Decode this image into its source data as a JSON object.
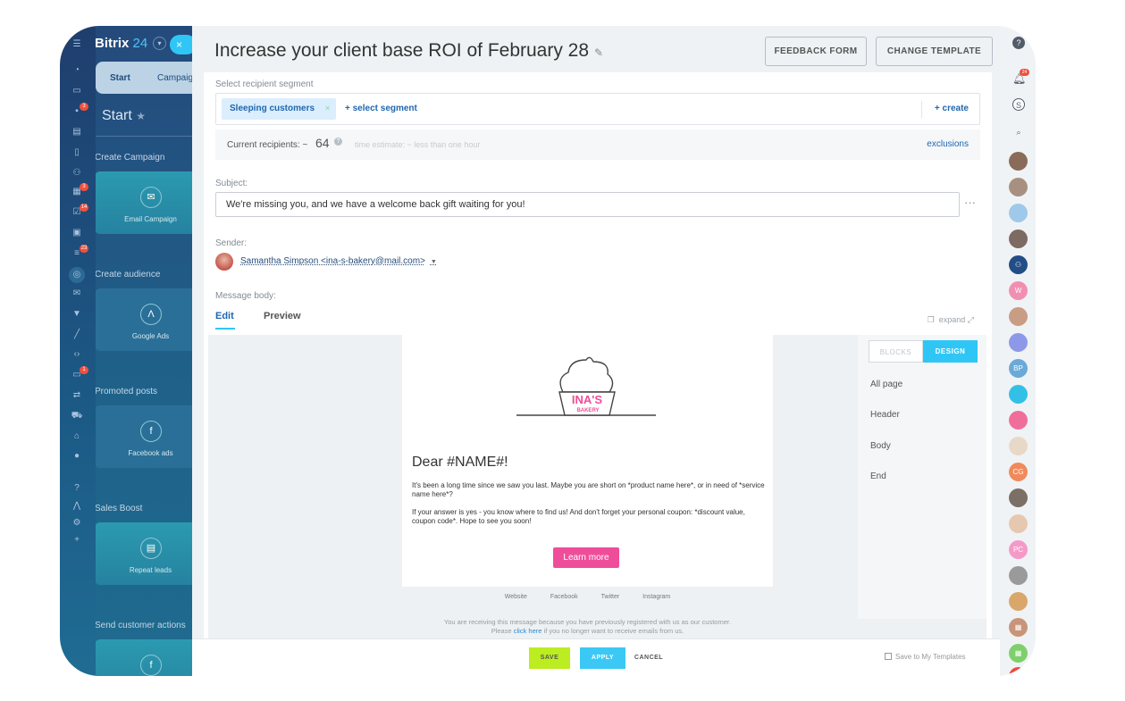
{
  "app": {
    "brand": "Bitrix",
    "brand_suffix": "24",
    "close_icon": "×"
  },
  "left_panel": {
    "tabs": [
      "Start",
      "Campaig"
    ],
    "start_title": "Start",
    "sections": [
      {
        "heading": "Create Campaign",
        "card": "Email Campaign",
        "icon": "envelope-icon"
      },
      {
        "heading": "Create audience",
        "card": "Google Ads",
        "icon": "google-ads-icon"
      },
      {
        "heading": "Promoted posts",
        "card": "Facebook ads",
        "icon": "facebook-icon"
      },
      {
        "heading": "Sales Boost",
        "card": "Repeat leads",
        "icon": "repeat-leads-icon"
      },
      {
        "heading": "Send customer actions",
        "card": "",
        "icon": "facebook-icon"
      }
    ]
  },
  "rail_badges": [
    "3",
    "3",
    "14",
    "23",
    "1"
  ],
  "header": {
    "title": "Increase your client base ROI of February 28",
    "feedback_button": "FEEDBACK FORM",
    "change_template_button": "CHANGE TEMPLATE"
  },
  "form": {
    "segment_label": "Select recipient segment",
    "segment_chip": "Sleeping customers",
    "select_segment": "+ select segment",
    "create": "+ create",
    "recipients_label": "Current recipients: ~",
    "recipients_count": "64",
    "time_estimate": "time estimate: ~ less than one hour",
    "exclusions": "exclusions",
    "subject_label": "Subject:",
    "subject_value": "We're missing you, and we have a welcome back gift waiting for you!",
    "sender_label": "Sender:",
    "sender_value": "Samantha Simpson <ina-s-bakery@mail.com>",
    "body_label": "Message body:",
    "tab_edit": "Edit",
    "tab_preview": "Preview",
    "expand": "expand"
  },
  "email": {
    "logo_text": "INA'S",
    "logo_sub": "BAKERY",
    "greeting": "Dear #NAME#!",
    "para1": "It's been a long time since we saw you last. Maybe you are short on *product name here*, or in need of *service name here*?",
    "para2": "If your answer is yes - you know where to find us! And don't forget your personal coupon: *discount value, coupon code*. Hope to see you soon!",
    "button": "Learn more",
    "footer_links": [
      "Website",
      "Facebook",
      "Twitter",
      "Instagram"
    ],
    "footer_note_1": "You are receiving this message because you have previously registered with us as our customer.",
    "footer_note_2a": "Please",
    "footer_note_link": "click here",
    "footer_note_2b": "if you no longer want to receive emails from us."
  },
  "design_panel": {
    "tab_blocks": "BLOCKS",
    "tab_design": "DESIGN",
    "items": [
      "All page",
      "Header",
      "Body",
      "End"
    ]
  },
  "bottom_bar": {
    "save": "SAVE",
    "apply": "APPLY",
    "cancel": "CANCEL",
    "save_template": "Save to My Templates"
  },
  "right_rail": {
    "notification_badge": "24",
    "avatar_initials": [
      "W",
      "BP",
      "CG",
      "PC"
    ]
  },
  "colors": {
    "accent": "#2fc6f6",
    "save": "#bbed21",
    "cta": "#ef4d9a",
    "link": "#2067b0"
  }
}
